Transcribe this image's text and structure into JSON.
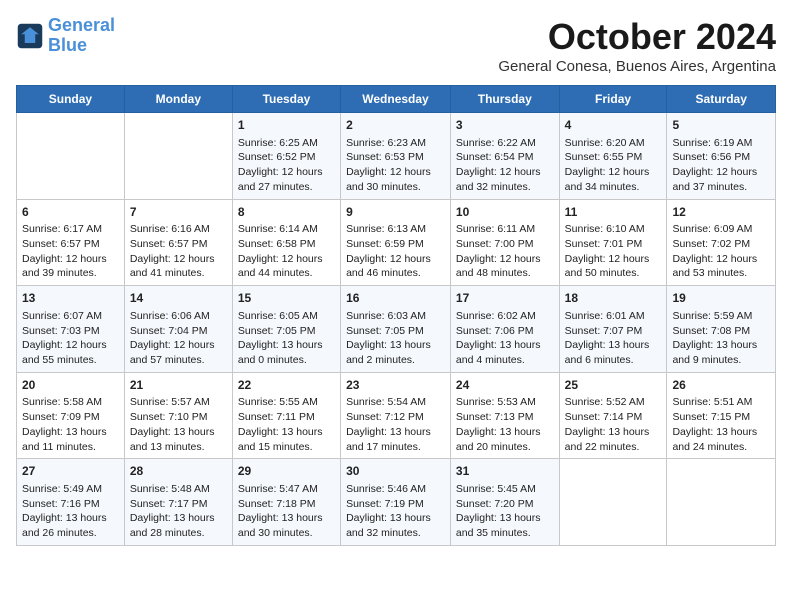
{
  "logo": {
    "line1": "General",
    "line2": "Blue"
  },
  "title": "October 2024",
  "subtitle": "General Conesa, Buenos Aires, Argentina",
  "days_of_week": [
    "Sunday",
    "Monday",
    "Tuesday",
    "Wednesday",
    "Thursday",
    "Friday",
    "Saturday"
  ],
  "weeks": [
    [
      {
        "day": "",
        "content": ""
      },
      {
        "day": "",
        "content": ""
      },
      {
        "day": "1",
        "content": "Sunrise: 6:25 AM\nSunset: 6:52 PM\nDaylight: 12 hours\nand 27 minutes."
      },
      {
        "day": "2",
        "content": "Sunrise: 6:23 AM\nSunset: 6:53 PM\nDaylight: 12 hours\nand 30 minutes."
      },
      {
        "day": "3",
        "content": "Sunrise: 6:22 AM\nSunset: 6:54 PM\nDaylight: 12 hours\nand 32 minutes."
      },
      {
        "day": "4",
        "content": "Sunrise: 6:20 AM\nSunset: 6:55 PM\nDaylight: 12 hours\nand 34 minutes."
      },
      {
        "day": "5",
        "content": "Sunrise: 6:19 AM\nSunset: 6:56 PM\nDaylight: 12 hours\nand 37 minutes."
      }
    ],
    [
      {
        "day": "6",
        "content": "Sunrise: 6:17 AM\nSunset: 6:57 PM\nDaylight: 12 hours\nand 39 minutes."
      },
      {
        "day": "7",
        "content": "Sunrise: 6:16 AM\nSunset: 6:57 PM\nDaylight: 12 hours\nand 41 minutes."
      },
      {
        "day": "8",
        "content": "Sunrise: 6:14 AM\nSunset: 6:58 PM\nDaylight: 12 hours\nand 44 minutes."
      },
      {
        "day": "9",
        "content": "Sunrise: 6:13 AM\nSunset: 6:59 PM\nDaylight: 12 hours\nand 46 minutes."
      },
      {
        "day": "10",
        "content": "Sunrise: 6:11 AM\nSunset: 7:00 PM\nDaylight: 12 hours\nand 48 minutes."
      },
      {
        "day": "11",
        "content": "Sunrise: 6:10 AM\nSunset: 7:01 PM\nDaylight: 12 hours\nand 50 minutes."
      },
      {
        "day": "12",
        "content": "Sunrise: 6:09 AM\nSunset: 7:02 PM\nDaylight: 12 hours\nand 53 minutes."
      }
    ],
    [
      {
        "day": "13",
        "content": "Sunrise: 6:07 AM\nSunset: 7:03 PM\nDaylight: 12 hours\nand 55 minutes."
      },
      {
        "day": "14",
        "content": "Sunrise: 6:06 AM\nSunset: 7:04 PM\nDaylight: 12 hours\nand 57 minutes."
      },
      {
        "day": "15",
        "content": "Sunrise: 6:05 AM\nSunset: 7:05 PM\nDaylight: 13 hours\nand 0 minutes."
      },
      {
        "day": "16",
        "content": "Sunrise: 6:03 AM\nSunset: 7:05 PM\nDaylight: 13 hours\nand 2 minutes."
      },
      {
        "day": "17",
        "content": "Sunrise: 6:02 AM\nSunset: 7:06 PM\nDaylight: 13 hours\nand 4 minutes."
      },
      {
        "day": "18",
        "content": "Sunrise: 6:01 AM\nSunset: 7:07 PM\nDaylight: 13 hours\nand 6 minutes."
      },
      {
        "day": "19",
        "content": "Sunrise: 5:59 AM\nSunset: 7:08 PM\nDaylight: 13 hours\nand 9 minutes."
      }
    ],
    [
      {
        "day": "20",
        "content": "Sunrise: 5:58 AM\nSunset: 7:09 PM\nDaylight: 13 hours\nand 11 minutes."
      },
      {
        "day": "21",
        "content": "Sunrise: 5:57 AM\nSunset: 7:10 PM\nDaylight: 13 hours\nand 13 minutes."
      },
      {
        "day": "22",
        "content": "Sunrise: 5:55 AM\nSunset: 7:11 PM\nDaylight: 13 hours\nand 15 minutes."
      },
      {
        "day": "23",
        "content": "Sunrise: 5:54 AM\nSunset: 7:12 PM\nDaylight: 13 hours\nand 17 minutes."
      },
      {
        "day": "24",
        "content": "Sunrise: 5:53 AM\nSunset: 7:13 PM\nDaylight: 13 hours\nand 20 minutes."
      },
      {
        "day": "25",
        "content": "Sunrise: 5:52 AM\nSunset: 7:14 PM\nDaylight: 13 hours\nand 22 minutes."
      },
      {
        "day": "26",
        "content": "Sunrise: 5:51 AM\nSunset: 7:15 PM\nDaylight: 13 hours\nand 24 minutes."
      }
    ],
    [
      {
        "day": "27",
        "content": "Sunrise: 5:49 AM\nSunset: 7:16 PM\nDaylight: 13 hours\nand 26 minutes."
      },
      {
        "day": "28",
        "content": "Sunrise: 5:48 AM\nSunset: 7:17 PM\nDaylight: 13 hours\nand 28 minutes."
      },
      {
        "day": "29",
        "content": "Sunrise: 5:47 AM\nSunset: 7:18 PM\nDaylight: 13 hours\nand 30 minutes."
      },
      {
        "day": "30",
        "content": "Sunrise: 5:46 AM\nSunset: 7:19 PM\nDaylight: 13 hours\nand 32 minutes."
      },
      {
        "day": "31",
        "content": "Sunrise: 5:45 AM\nSunset: 7:20 PM\nDaylight: 13 hours\nand 35 minutes."
      },
      {
        "day": "",
        "content": ""
      },
      {
        "day": "",
        "content": ""
      }
    ]
  ]
}
